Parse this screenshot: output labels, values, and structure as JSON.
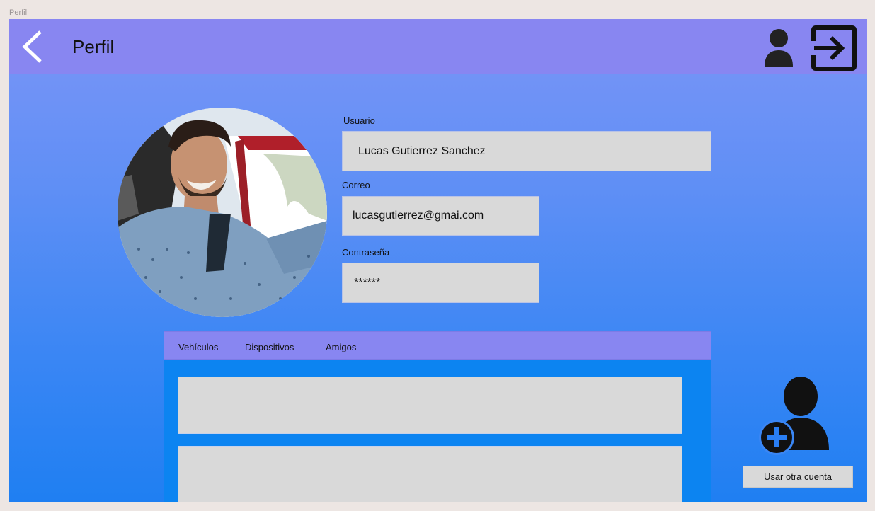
{
  "frame": {
    "label": "Perfil"
  },
  "header": {
    "title": "Perfil",
    "back_icon": "chevron-left-icon",
    "user_icon": "user-icon",
    "logout_icon": "logout-icon"
  },
  "profile": {
    "photo": "profile-photo",
    "fields": {
      "username": {
        "label": "Usuario",
        "value": "Lucas Gutierrez Sanchez"
      },
      "email": {
        "label": "Correo",
        "value": "lucasgutierrez@gmai.com"
      },
      "password": {
        "label": "Contraseña",
        "value": "******"
      }
    }
  },
  "tabs": [
    {
      "label": "Vehículos"
    },
    {
      "label": "Dispositivos"
    },
    {
      "label": "Amigos"
    }
  ],
  "actions": {
    "add_user_icon": "add-user-icon",
    "switch_account_label": "Usar otra cuenta"
  },
  "colors": {
    "header": "#8886f1",
    "panel": "#0c84f1",
    "field": "#d9d9d9",
    "gradient_top": "#7b95f7",
    "gradient_bottom": "#1f7ff2"
  }
}
